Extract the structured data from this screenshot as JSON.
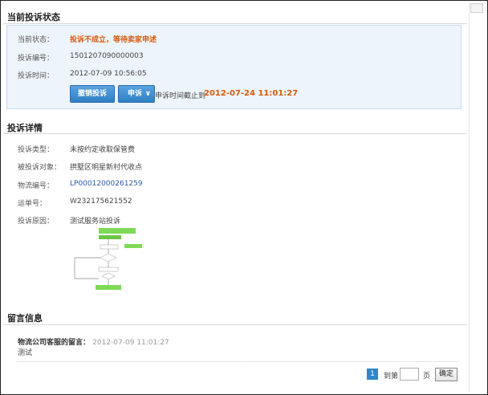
{
  "current_status": {
    "title": "当前投诉状态",
    "status_label": "当前状态：",
    "status_value": "投诉不成立，等待卖家申述",
    "id_label": "投诉编号：",
    "id_value": "1501207090000003",
    "time_label": "投诉时间：",
    "time_value": "2012-07-09 10:56:05",
    "withdraw_button": "撤销投诉",
    "appeal_button": "申诉",
    "deadline_text": "申诉时间截止到",
    "deadline_date": "2012-07-24 11:01:27"
  },
  "details": {
    "title": "投诉详情",
    "type_label": "投诉类型：",
    "type_value": "未按约定收取保管费",
    "target_label": "被投诉对象：",
    "target_value": "拱墅区明星新村代收点",
    "logistics_label": "物流编号：",
    "logistics_value": "LP00012000261259",
    "waybill_label": "运单号：",
    "waybill_value": "W232175621552",
    "reason_label": "投诉原因：",
    "reason_value": "测试服务站投诉"
  },
  "messages": {
    "title": "留言信息",
    "items": [
      {
        "author": "物流公司客服的留言：",
        "time": "2012-07-09 11:01:27",
        "content": "测试"
      }
    ]
  },
  "pagination": {
    "current_page": "1",
    "goto_label": "到第",
    "page_suffix": "页",
    "confirm_button": "确定"
  },
  "colors": {
    "accent_blue": "#2f7fc4",
    "status_orange": "#d9590a",
    "status_box_bg": "#edf4fb"
  }
}
